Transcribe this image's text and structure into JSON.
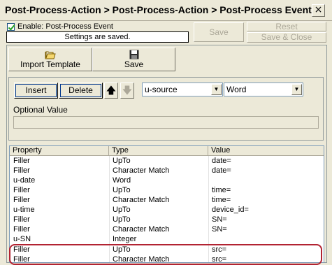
{
  "window": {
    "title": "Post-Process-Action > Post-Process-Action > Post-Process Event",
    "close_glyph": "×"
  },
  "header": {
    "enable_label": "Enable: Post-Process Event",
    "enable_checked": true,
    "status_text": "Settings are saved.",
    "save_label": "Save",
    "reset_label": "Reset",
    "save_close_label": "Save & Close"
  },
  "toolbar": {
    "import_label": "Import Template",
    "import_icon": "folder-open-icon",
    "save_label": "Save",
    "save_icon": "floppy-disk-icon"
  },
  "editor": {
    "insert_label": "Insert",
    "delete_label": "Delete",
    "up_glyph": "🡅",
    "down_glyph": "🡇",
    "property_select": "u-source",
    "type_select": "Word",
    "optional_label": "Optional Value",
    "optional_value": ""
  },
  "grid": {
    "columns": [
      "Property",
      "Type",
      "Value"
    ],
    "rows": [
      {
        "property": "Filler",
        "type": "UpTo",
        "value": "date="
      },
      {
        "property": "Filler",
        "type": "Character Match",
        "value": "date="
      },
      {
        "property": "u-date",
        "type": "Word",
        "value": ""
      },
      {
        "property": "Filler",
        "type": "UpTo",
        "value": "time="
      },
      {
        "property": "Filler",
        "type": "Character Match",
        "value": "time="
      },
      {
        "property": "u-time",
        "type": "UpTo",
        "value": " device_id="
      },
      {
        "property": "Filler",
        "type": "UpTo",
        "value": "SN="
      },
      {
        "property": "Filler",
        "type": "Character Match",
        "value": "SN="
      },
      {
        "property": "u-SN",
        "type": "Integer",
        "value": ""
      },
      {
        "property": "Filler",
        "type": "UpTo",
        "value": "src="
      },
      {
        "property": "Filler",
        "type": "Character Match",
        "value": "src="
      }
    ]
  },
  "colors": {
    "highlight": "#b22332",
    "background": "#ece9d8"
  }
}
